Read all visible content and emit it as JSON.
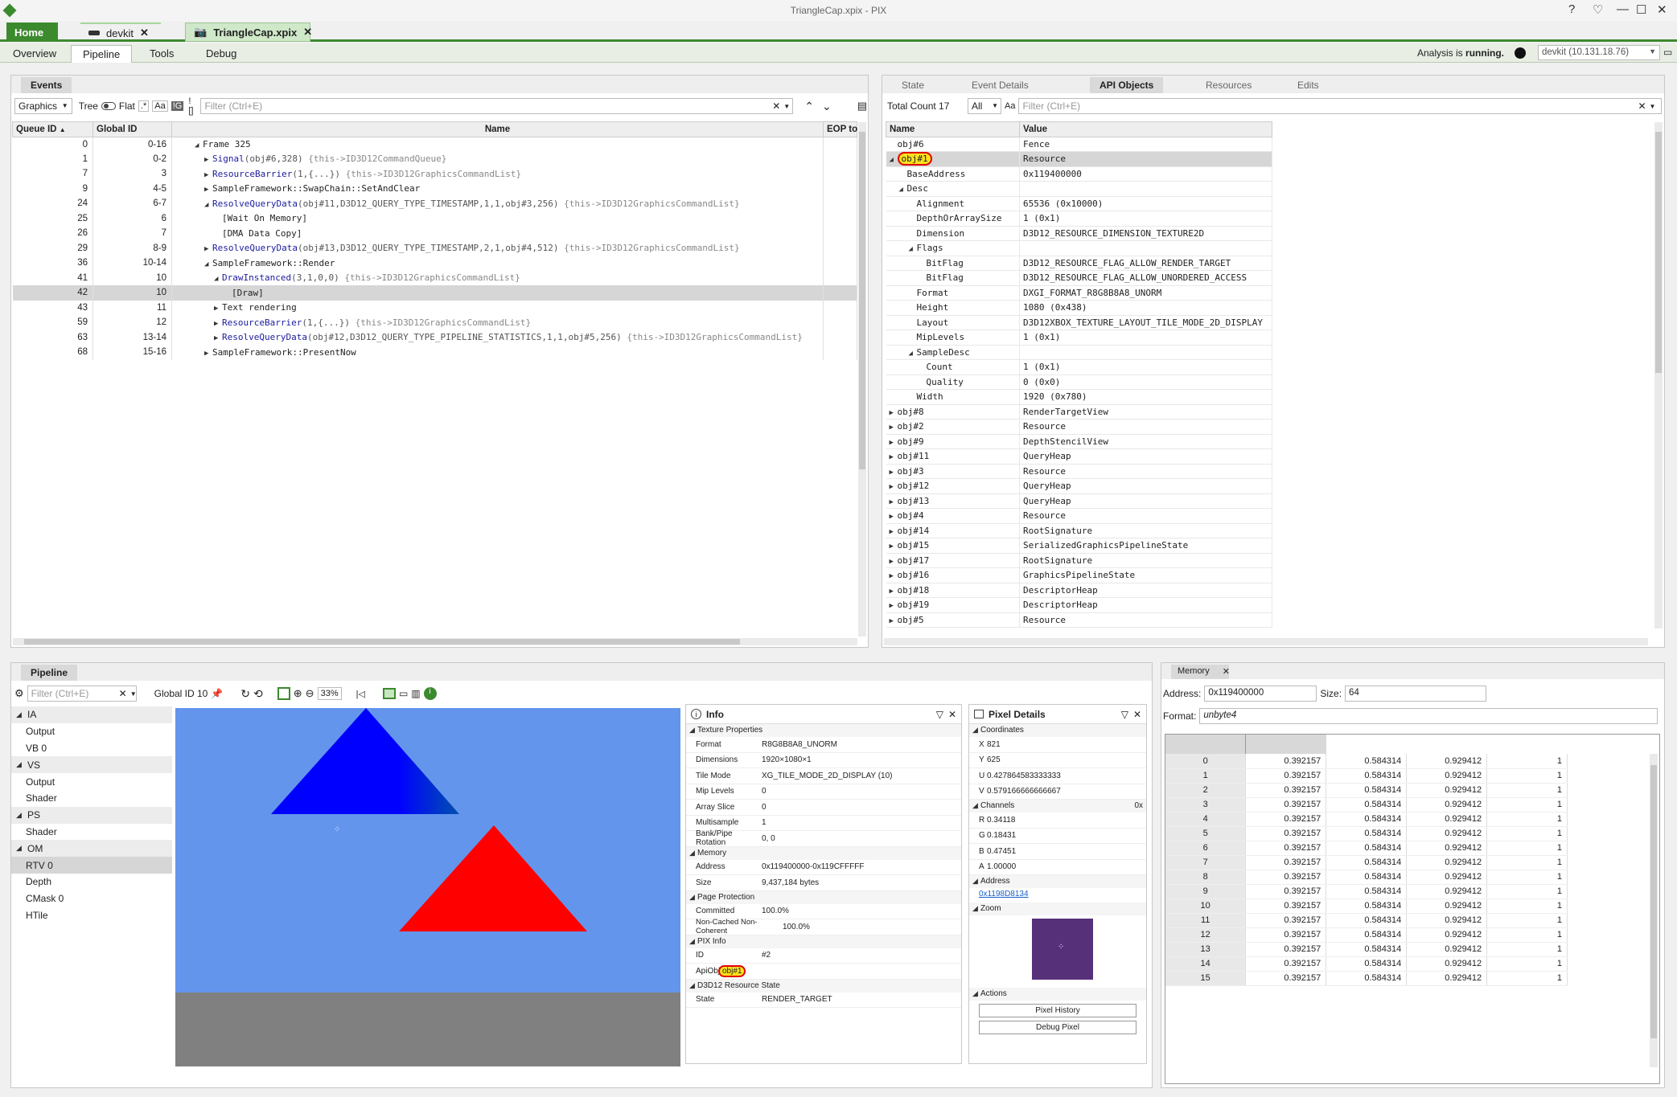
{
  "app": {
    "title": "TriangleCap.xpix - PIX"
  },
  "tabs": {
    "home": "Home",
    "devkit": "devkit",
    "file": "TriangleCap.xpix"
  },
  "nav": {
    "overview": "Overview",
    "pipeline": "Pipeline",
    "tools": "Tools",
    "debug": "Debug"
  },
  "status": {
    "analysis": "Analysis is",
    "running": "running.",
    "device": "devkit (10.131.18.76)"
  },
  "events": {
    "tab": "Events",
    "filter_mode": "Graphics",
    "tree": "Tree",
    "flat": "Flat",
    "regex": ".*",
    "case": "Aa",
    "ig": "!G",
    "brk": "![]",
    "placeholder": "Filter (Ctrl+E)",
    "columns": [
      "Queue ID",
      "Global ID",
      "Name",
      "EOP to"
    ],
    "rows": [
      {
        "q": "0",
        "g": "0-16",
        "fn": "Frame 325",
        "args": "",
        "cmt": "",
        "ind": 0,
        "exp": "open",
        "plain": true
      },
      {
        "q": "1",
        "g": "0-2",
        "fn": "Signal",
        "args": "(obj#6,328)",
        "cmt": "{this->ID3D12CommandQueue}",
        "ind": 1,
        "exp": "closed"
      },
      {
        "q": "7",
        "g": "3",
        "fn": "ResourceBarrier",
        "args": "(1,{...})",
        "cmt": "{this->ID3D12GraphicsCommandList}",
        "ind": 1,
        "exp": "closed"
      },
      {
        "q": "9",
        "g": "4-5",
        "fn": "SampleFramework::SwapChain::SetAndClear",
        "args": "",
        "cmt": "",
        "ind": 1,
        "exp": "closed",
        "plain": true
      },
      {
        "q": "24",
        "g": "6-7",
        "fn": "ResolveQueryData",
        "args": "(obj#11,D3D12_QUERY_TYPE_TIMESTAMP,1,1,obj#3,256)",
        "cmt": "{this->ID3D12GraphicsCommandList}",
        "ind": 1,
        "exp": "open"
      },
      {
        "q": "25",
        "g": "6",
        "fn": "[Wait On Memory]",
        "args": "",
        "cmt": "",
        "ind": 2,
        "exp": "",
        "plain": true
      },
      {
        "q": "26",
        "g": "7",
        "fn": "[DMA Data Copy]",
        "args": "",
        "cmt": "",
        "ind": 2,
        "exp": "",
        "plain": true
      },
      {
        "q": "29",
        "g": "8-9",
        "fn": "ResolveQueryData",
        "args": "(obj#13,D3D12_QUERY_TYPE_TIMESTAMP,2,1,obj#4,512)",
        "cmt": "{this->ID3D12GraphicsCommandList}",
        "ind": 1,
        "exp": "closed"
      },
      {
        "q": "36",
        "g": "10-14",
        "fn": "SampleFramework::Render",
        "args": "",
        "cmt": "",
        "ind": 1,
        "exp": "open",
        "plain": true
      },
      {
        "q": "41",
        "g": "10",
        "fn": "DrawInstanced",
        "args": "(3,1,0,0)",
        "cmt": "{this->ID3D12GraphicsCommandList}",
        "ind": 2,
        "exp": "open"
      },
      {
        "q": "42",
        "g": "10",
        "fn": "[Draw]",
        "args": "",
        "cmt": "",
        "ind": 3,
        "exp": "",
        "plain": true,
        "sel": true
      },
      {
        "q": "43",
        "g": "11",
        "fn": "Text rendering",
        "args": "",
        "cmt": "",
        "ind": 2,
        "exp": "closed",
        "plain": true
      },
      {
        "q": "59",
        "g": "12",
        "fn": "ResourceBarrier",
        "args": "(1,{...})",
        "cmt": "{this->ID3D12GraphicsCommandList}",
        "ind": 2,
        "exp": "closed"
      },
      {
        "q": "63",
        "g": "13-14",
        "fn": "ResolveQueryData",
        "args": "(obj#12,D3D12_QUERY_TYPE_PIPELINE_STATISTICS,1,1,obj#5,256)",
        "cmt": "{this->ID3D12GraphicsCommandList}",
        "ind": 2,
        "exp": "closed"
      },
      {
        "q": "68",
        "g": "15-16",
        "fn": "SampleFramework::PresentNow",
        "args": "",
        "cmt": "",
        "ind": 1,
        "exp": "closed",
        "plain": true
      }
    ]
  },
  "api": {
    "tabs": [
      "State",
      "Event Details",
      "API Objects",
      "Resources",
      "Edits"
    ],
    "total": "Total Count 17",
    "filter_all": "All",
    "case": "Aa",
    "placeholder": "Filter (Ctrl+E)",
    "columns": [
      "Name",
      "Value"
    ],
    "rows": [
      {
        "n": "obj#6",
        "v": "Fence",
        "ind": 0,
        "exp": ""
      },
      {
        "n": "obj#1",
        "v": "Resource",
        "ind": 0,
        "exp": "open",
        "sel": true,
        "hl": true
      },
      {
        "n": "BaseAddress",
        "v": "0x119400000",
        "ind": 1,
        "exp": ""
      },
      {
        "n": "Desc",
        "v": "",
        "ind": 1,
        "exp": "open"
      },
      {
        "n": "Alignment",
        "v": "65536 (0x10000)",
        "ind": 2,
        "exp": ""
      },
      {
        "n": "DepthOrArraySize",
        "v": "1 (0x1)",
        "ind": 2,
        "exp": ""
      },
      {
        "n": "Dimension",
        "v": "D3D12_RESOURCE_DIMENSION_TEXTURE2D",
        "ind": 2,
        "exp": ""
      },
      {
        "n": "Flags",
        "v": "",
        "ind": 2,
        "exp": "open"
      },
      {
        "n": "BitFlag",
        "v": "D3D12_RESOURCE_FLAG_ALLOW_RENDER_TARGET",
        "ind": 3,
        "exp": ""
      },
      {
        "n": "BitFlag",
        "v": "D3D12_RESOURCE_FLAG_ALLOW_UNORDERED_ACCESS",
        "ind": 3,
        "exp": ""
      },
      {
        "n": "Format",
        "v": "DXGI_FORMAT_R8G8B8A8_UNORM",
        "ind": 2,
        "exp": ""
      },
      {
        "n": "Height",
        "v": "1080 (0x438)",
        "ind": 2,
        "exp": ""
      },
      {
        "n": "Layout",
        "v": "D3D12XBOX_TEXTURE_LAYOUT_TILE_MODE_2D_DISPLAY",
        "ind": 2,
        "exp": ""
      },
      {
        "n": "MipLevels",
        "v": "1 (0x1)",
        "ind": 2,
        "exp": ""
      },
      {
        "n": "SampleDesc",
        "v": "",
        "ind": 2,
        "exp": "open"
      },
      {
        "n": "Count",
        "v": "1 (0x1)",
        "ind": 3,
        "exp": ""
      },
      {
        "n": "Quality",
        "v": "0 (0x0)",
        "ind": 3,
        "exp": ""
      },
      {
        "n": "Width",
        "v": "1920 (0x780)",
        "ind": 2,
        "exp": ""
      },
      {
        "n": "obj#8",
        "v": "RenderTargetView",
        "ind": 0,
        "exp": "closed"
      },
      {
        "n": "obj#2",
        "v": "Resource",
        "ind": 0,
        "exp": "closed"
      },
      {
        "n": "obj#9",
        "v": "DepthStencilView",
        "ind": 0,
        "exp": "closed"
      },
      {
        "n": "obj#11",
        "v": "QueryHeap",
        "ind": 0,
        "exp": "closed"
      },
      {
        "n": "obj#3",
        "v": "Resource",
        "ind": 0,
        "exp": "closed"
      },
      {
        "n": "obj#12",
        "v": "QueryHeap",
        "ind": 0,
        "exp": "closed"
      },
      {
        "n": "obj#13",
        "v": "QueryHeap",
        "ind": 0,
        "exp": "closed"
      },
      {
        "n": "obj#4",
        "v": "Resource",
        "ind": 0,
        "exp": "closed"
      },
      {
        "n": "obj#14",
        "v": "RootSignature",
        "ind": 0,
        "exp": "closed"
      },
      {
        "n": "obj#15",
        "v": "SerializedGraphicsPipelineState",
        "ind": 0,
        "exp": "closed"
      },
      {
        "n": "obj#17",
        "v": "RootSignature",
        "ind": 0,
        "exp": "closed"
      },
      {
        "n": "obj#16",
        "v": "GraphicsPipelineState",
        "ind": 0,
        "exp": "closed"
      },
      {
        "n": "obj#18",
        "v": "DescriptorHeap",
        "ind": 0,
        "exp": "closed"
      },
      {
        "n": "obj#19",
        "v": "DescriptorHeap",
        "ind": 0,
        "exp": "closed"
      },
      {
        "n": "obj#5",
        "v": "Resource",
        "ind": 0,
        "exp": "closed"
      }
    ]
  },
  "pipeline": {
    "tab": "Pipeline",
    "placeholder": "Filter (Ctrl+E)",
    "global_id": "Global ID 10",
    "zoom": "33%",
    "tree": [
      {
        "t": "IA",
        "h": true
      },
      {
        "t": "Output"
      },
      {
        "t": "VB 0"
      },
      {
        "t": "VS",
        "h": true
      },
      {
        "t": "Output"
      },
      {
        "t": "Shader"
      },
      {
        "t": "PS",
        "h": true
      },
      {
        "t": "Shader"
      },
      {
        "t": "OM",
        "h": true
      },
      {
        "t": "RTV 0",
        "sel": true
      },
      {
        "t": "Depth"
      },
      {
        "t": "CMask 0"
      },
      {
        "t": "HTile"
      }
    ],
    "colors": {
      "clear": "#6495ED",
      "floor": "#808080"
    }
  },
  "info": {
    "title": "Info",
    "sections": [
      {
        "name": "Texture Properties",
        "items": [
          [
            "Format",
            "R8G8B8A8_UNORM"
          ],
          [
            "Dimensions",
            "1920×1080×1"
          ],
          [
            "Tile Mode",
            "XG_TILE_MODE_2D_DISPLAY (10)"
          ],
          [
            "Mip Levels",
            "0"
          ],
          [
            "Array Slice",
            "0"
          ],
          [
            "Multisample",
            "1"
          ],
          [
            "Bank/Pipe Rotation",
            "0, 0"
          ]
        ]
      },
      {
        "name": "Memory",
        "items": [
          [
            "Address",
            "0x119400000-0x119CFFFFF"
          ],
          [
            "Size",
            "9,437,184 bytes"
          ]
        ]
      },
      {
        "name": "Page Protection",
        "items": [
          [
            "Committed",
            "100.0%"
          ],
          [
            "Non-Cached Non-Coherent",
            "100.0%"
          ]
        ]
      },
      {
        "name": "PIX Info",
        "items": [
          [
            "ID",
            "#2"
          ],
          [
            "ApiObject",
            "obj#1"
          ]
        ]
      },
      {
        "name": "D3D12 Resource State",
        "items": [
          [
            "State",
            "RENDER_TARGET"
          ]
        ]
      }
    ]
  },
  "pixel": {
    "title": "Pixel Details",
    "coords_label": "Coordinates",
    "coords": [
      [
        "X",
        "821"
      ],
      [
        "Y",
        "625"
      ],
      [
        "U",
        "0.427864583333333"
      ],
      [
        "V",
        "0.579166666666667"
      ]
    ],
    "channels_label": "Channels",
    "hex": "0x",
    "channels": [
      [
        "R",
        "0.34118"
      ],
      [
        "G",
        "0.18431"
      ],
      [
        "B",
        "0.47451"
      ],
      [
        "A",
        "1.00000"
      ]
    ],
    "address_label": "Address",
    "address": "0x1198D8134",
    "zoom_label": "Zoom",
    "zoom_color": "#57307a",
    "actions_label": "Actions",
    "history": "Pixel History",
    "debug": "Debug Pixel"
  },
  "memory": {
    "tab": "Memory",
    "address_label": "Address:",
    "address": "0x119400000",
    "size_label": "Size:",
    "size": "64",
    "format_label": "Format:",
    "format": "unbyte4",
    "rows": [
      [
        "0",
        "0.392157",
        "0.584314",
        "0.929412",
        "1"
      ],
      [
        "1",
        "0.392157",
        "0.584314",
        "0.929412",
        "1"
      ],
      [
        "2",
        "0.392157",
        "0.584314",
        "0.929412",
        "1"
      ],
      [
        "3",
        "0.392157",
        "0.584314",
        "0.929412",
        "1"
      ],
      [
        "4",
        "0.392157",
        "0.584314",
        "0.929412",
        "1"
      ],
      [
        "5",
        "0.392157",
        "0.584314",
        "0.929412",
        "1"
      ],
      [
        "6",
        "0.392157",
        "0.584314",
        "0.929412",
        "1"
      ],
      [
        "7",
        "0.392157",
        "0.584314",
        "0.929412",
        "1"
      ],
      [
        "8",
        "0.392157",
        "0.584314",
        "0.929412",
        "1"
      ],
      [
        "9",
        "0.392157",
        "0.584314",
        "0.929412",
        "1"
      ],
      [
        "10",
        "0.392157",
        "0.584314",
        "0.929412",
        "1"
      ],
      [
        "11",
        "0.392157",
        "0.584314",
        "0.929412",
        "1"
      ],
      [
        "12",
        "0.392157",
        "0.584314",
        "0.929412",
        "1"
      ],
      [
        "13",
        "0.392157",
        "0.584314",
        "0.929412",
        "1"
      ],
      [
        "14",
        "0.392157",
        "0.584314",
        "0.929412",
        "1"
      ],
      [
        "15",
        "0.392157",
        "0.584314",
        "0.929412",
        "1"
      ]
    ]
  }
}
